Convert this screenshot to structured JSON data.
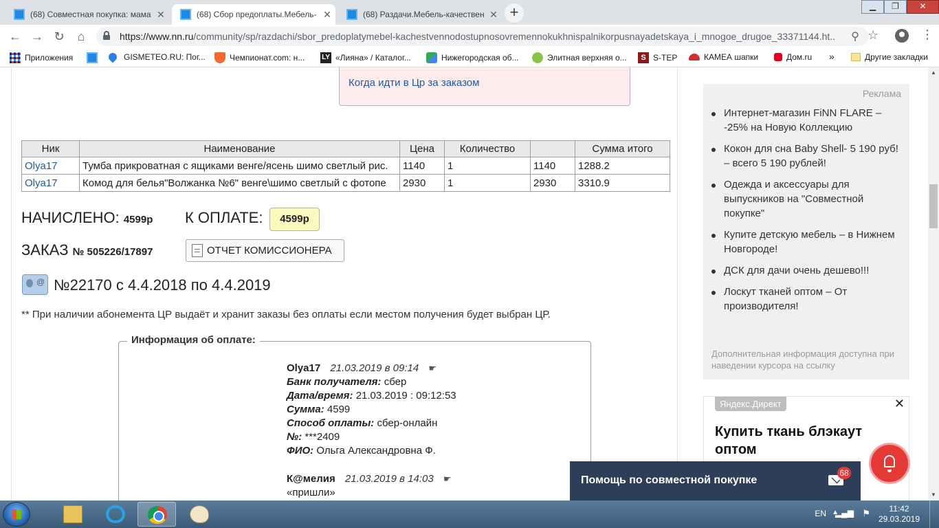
{
  "browser": {
    "tabs": [
      {
        "title": "(68) Совместная покупка: мама"
      },
      {
        "title": "(68) Сбор предоплаты.Мебель-"
      },
      {
        "title": "(68) Раздачи.Мебель-качествен"
      }
    ],
    "url_host": "https://www.nn.ru",
    "url_path": "/community/sp/razdachi/sbor_predoplatymebel-kachestvennodostupnosovremennokukhnispalnikorpusnayadetskaya_i_mnogoe_drugoe_33371144.ht...",
    "bookmarks": [
      {
        "label": "Приложения",
        "icon": "apps-grid-icon",
        "color": "#4285f4"
      },
      {
        "label": "",
        "icon": "site-icon",
        "color": "#1e88e5"
      },
      {
        "label": "GISMETEO.RU: Пог...",
        "icon": "drop-icon",
        "color": "#2b7de9"
      },
      {
        "label": "Чемпионат.com: н...",
        "icon": "shield-icon",
        "color": "#f06b2d"
      },
      {
        "label": "«Лияна» / Каталог...",
        "icon": "ly-icon",
        "color": "#222222"
      },
      {
        "label": "Нижегородская об...",
        "icon": "maps-icon",
        "color": "#34a853"
      },
      {
        "label": "Элитная верхняя о...",
        "icon": "smile-icon",
        "color": "#8bc34a"
      },
      {
        "label": "S-TEP",
        "icon": "s-icon",
        "color": "#8b1a1a"
      },
      {
        "label": "КАМЕА шапки",
        "icon": "hat-icon",
        "color": "#d32f2f"
      },
      {
        "label": "Дом.ru",
        "icon": "domru-icon",
        "color": "#e0001b"
      }
    ],
    "bookmarks_more": "»",
    "other_bookmarks": "Другие закладки"
  },
  "notice": {
    "link": "Когда идти в Цр за заказом"
  },
  "orders": {
    "headers": [
      "Ник",
      "Наименование",
      "Цена",
      "Количество",
      "",
      "Сумма итого"
    ],
    "rows": [
      [
        "Olya17",
        "Тумба прикроватная с ящиками венге/ясень шимо светлый рис.",
        "1140",
        "1",
        "1140",
        "1288.2"
      ],
      [
        "Olya17",
        "Комод для белья\"Волжанка №6\" венге\\шимо светлый с фотопе",
        "2930",
        "1",
        "2930",
        "3310.9"
      ]
    ]
  },
  "summary": {
    "charged_label": "НАЧИСЛЕНО:",
    "charged_value": "4599р",
    "to_pay_label": "К ОПЛАТЕ:",
    "to_pay_value": "4599р",
    "order_label": "ЗАКАЗ",
    "order_value": "№ 505226/17897",
    "report_button": "ОТЧЕТ КОМИССИОНЕРА",
    "subscription": "№22170 с 4.4.2018 по 4.4.2019",
    "footnote": "** При наличии абонемента ЦР выдаёт и хранит заказы без оплаты если местом получения будет выбран ЦР."
  },
  "payment": {
    "legend": "Информация об оплате:",
    "entry1": {
      "user": "Olya17",
      "when": "21.03.2019 в 09:14",
      "bank_label": "Банк получателя:",
      "bank": "сбер",
      "datetime_label": "Дата/время:",
      "datetime": "21.03.2019 : 09:12:53",
      "sum_label": "Сумма:",
      "sum": "4599",
      "method_label": "Способ оплаты:",
      "method": "сбер-онлайн",
      "num_label": "№:",
      "num": "***2409",
      "fio_label": "ФИО:",
      "fio": "Ольга Александровна Ф."
    },
    "entry2": {
      "user": "К@мелия",
      "when": "21.03.2019 в 14:03",
      "text": "«пришли»"
    },
    "hand": "☛"
  },
  "ads": {
    "header": "Реклама",
    "items": [
      "Интернет-магазин FiNN FLARE – -25% на Новую Коллекцию",
      "Кокон для сна Baby Shell- 5 190 руб! – всего 5 190 рублей!",
      "Одежда и аксессуары для выпускников на \"Совместной покупке\"",
      "Купите детскую мебель – в Нижнем Новгороде!",
      "ДСК для дачи очень дешево!!!",
      "Лоскут тканей оптом – От производителя!"
    ],
    "note": "Дополнительная информация доступна при наведении курсора на ссылку"
  },
  "yandex": {
    "tag": "Яндекс.Директ",
    "close": "✕",
    "title": "Купить ткань блэкаут оптом"
  },
  "chat": {
    "label": "Помощь по совместной покупке",
    "count": "68"
  },
  "taskbar": {
    "lang": "EN",
    "time": "11:42",
    "date": "29.03.2019"
  }
}
